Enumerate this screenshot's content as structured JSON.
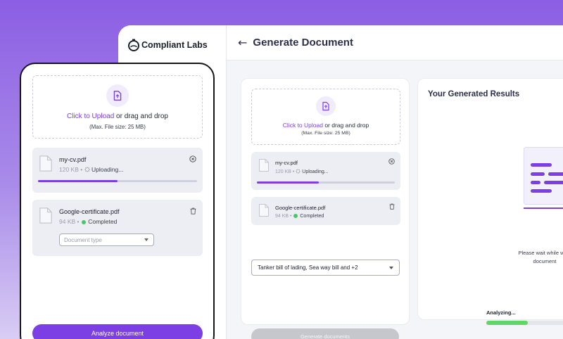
{
  "app": {
    "logo_text": "Compliant Labs",
    "page_title": "Generate Document",
    "upload": {
      "link_text": "Click to Upload",
      "rest_text": " or drag and drop",
      "size_note": "(Max. File size: 25 MB)"
    },
    "files": [
      {
        "name": "my-cv.pdf",
        "size": "120 KB",
        "status": "Uploading...",
        "progress_percent": 45
      },
      {
        "name": "Google-certificate.pdf",
        "size": "94 KB",
        "status": "Completed"
      }
    ],
    "document_select": {
      "value": "Tanker bill of lading, Sea way bill and +2"
    },
    "generate_button": "Generate documents",
    "results": {
      "title": "Your Generated Results",
      "wait_line1": "Please wait while we c",
      "wait_line2": "document",
      "analyzing_label": "Analyzing...",
      "analyzing_percent": 37
    }
  },
  "phone": {
    "upload": {
      "link_text": "Click to Upload",
      "rest_text": " or drag and drop",
      "size_note": "(Max. File size: 25 MB)"
    },
    "files": [
      {
        "name": "my-cv.pdf",
        "size": "120 KB",
        "status": "Uploading...",
        "progress_percent": 50
      },
      {
        "name": "Google-certificate.pdf",
        "size": "94 KB",
        "status": "Completed"
      }
    ],
    "doc_type_placeholder": "Document type",
    "analyze_button": "Analyze document"
  },
  "colors": {
    "accent": "#7b3fe4",
    "success": "#4cc46a",
    "analyzing": "#5dd867"
  },
  "icons": [
    "back-arrow-icon",
    "upload-icon",
    "document-icon",
    "close-icon",
    "trash-icon",
    "spinner-icon",
    "chevron-down-icon",
    "logo-icon"
  ]
}
